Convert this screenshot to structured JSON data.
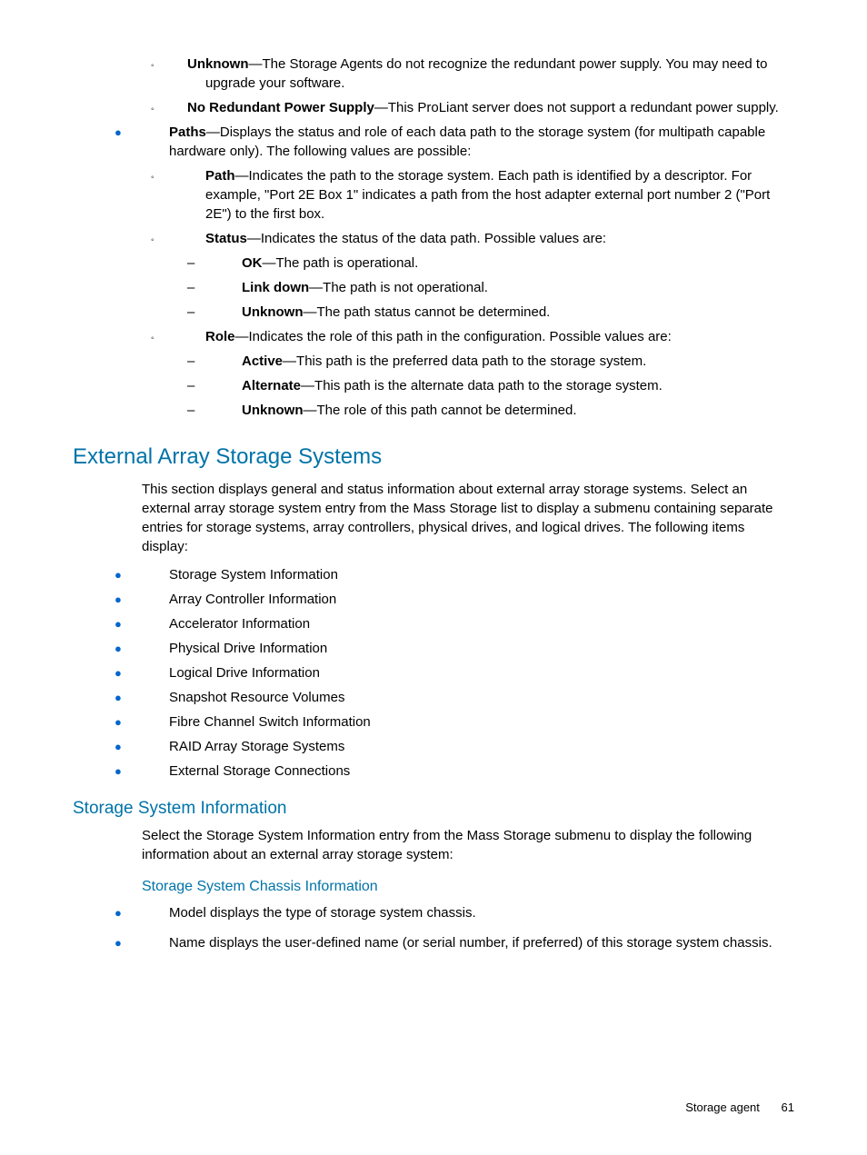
{
  "top_sublist": [
    {
      "term": "Unknown",
      "desc": "—The Storage Agents do not recognize the redundant power supply. You may need to upgrade your software."
    },
    {
      "term": "No Redundant Power Supply",
      "desc": "—This ProLiant server does not support a redundant power supply."
    }
  ],
  "paths": {
    "term": "Paths",
    "desc": "—Displays the status and role of each data path to the storage system (for multipath capable hardware only). The following values are possible:",
    "items": [
      {
        "term": "Path",
        "desc": "—Indicates the path to the storage system. Each path is identified by a descriptor. For example, \"Port 2E Box 1\" indicates a path from the host adapter external port number 2 (\"Port 2E\") to the first box."
      },
      {
        "term": "Status",
        "desc": "—Indicates the status of the data path. Possible values are:",
        "sub": [
          {
            "term": "OK",
            "desc": "—The path is operational."
          },
          {
            "term": "Link down",
            "desc": "—The path is not operational."
          },
          {
            "term": "Unknown",
            "desc": "—The path status cannot be determined."
          }
        ]
      },
      {
        "term": "Role",
        "desc": "—Indicates the role of this path in the configuration. Possible values are:",
        "sub": [
          {
            "term": "Active",
            "desc": "—This path is the preferred data path to the storage system."
          },
          {
            "term": "Alternate",
            "desc": "—This path is the alternate data path to the storage system."
          },
          {
            "term": "Unknown",
            "desc": "—The role of this path cannot be determined."
          }
        ]
      }
    ]
  },
  "ext_heading": "External Array Storage Systems",
  "ext_intro": "This section displays general and status information about external array storage systems. Select an external array storage system entry from the Mass Storage list to display a submenu containing separate entries for storage systems, array controllers, physical drives, and logical drives. The following items display:",
  "ext_list": [
    "Storage System Information",
    "Array Controller Information",
    "Accelerator Information",
    "Physical Drive Information",
    "Logical Drive Information",
    "Snapshot Resource Volumes",
    "Fibre Channel Switch Information",
    "RAID Array Storage Systems",
    "External Storage Connections"
  ],
  "ssi_heading": "Storage System Information",
  "ssi_intro": "Select the Storage System Information entry from the Mass Storage submenu to display the following information about an external array storage system:",
  "ssci_heading": "Storage System Chassis Information",
  "ssci_list": [
    "Model displays the type of storage system chassis.",
    "Name displays the user-defined name (or serial number, if preferred) of this storage system chassis."
  ],
  "footer_label": "Storage agent",
  "footer_page": "61"
}
